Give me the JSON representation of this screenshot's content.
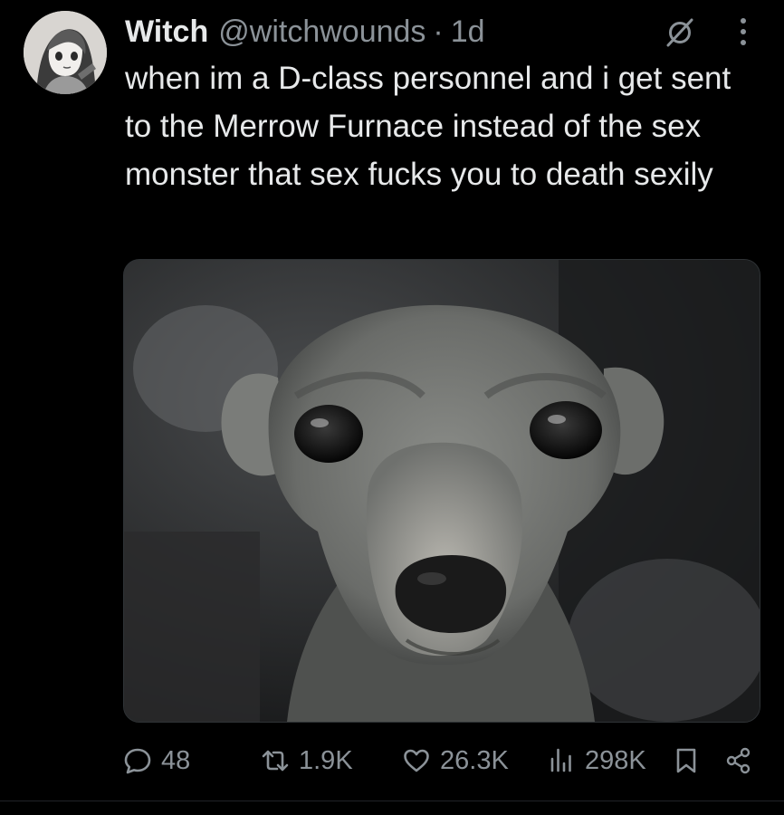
{
  "tweet": {
    "author_name": "Witch",
    "author_handle": "@witchwounds",
    "separator": "·",
    "time": "1d",
    "text": "when im a D-class personnel and i get sent to the Merrow Furnace instead of the sex monster that sex fucks you to death sexily",
    "icons": {
      "muted": "muted-circle-slash-icon",
      "more": "more-vertical-icon"
    }
  },
  "actions": {
    "reply_count": "48",
    "retweet_count": "1.9K",
    "like_count": "26.3K",
    "view_count": "298K"
  },
  "colors": {
    "background": "#000000",
    "text_primary": "#e7e9ea",
    "text_secondary": "#8b9298"
  }
}
